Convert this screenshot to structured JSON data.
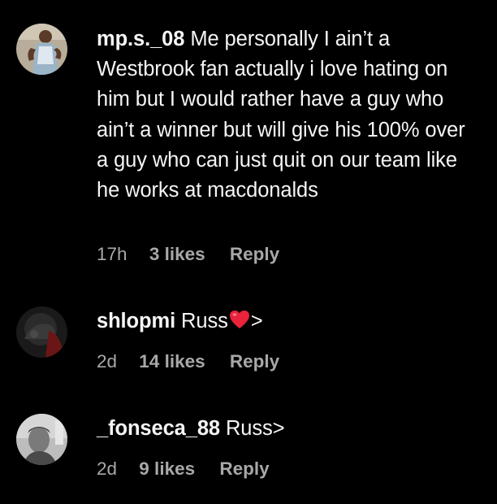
{
  "comments": [
    {
      "username": "mp.s._08",
      "text": " Me personally I ain’t a Westbrook fan actually i love hating on him but I would rather have a guy who ain’t a winner but will give his 100% over a guy who can just quit on our team like he works at macdonalds",
      "time": "17h",
      "likes": "3 likes",
      "reply": "Reply",
      "avatar_icon": "user-avatar-basketball-player"
    },
    {
      "username": "shlopmi",
      "text_before": " Russ",
      "text_after": ">",
      "emoji": "red-heart-icon",
      "time": "2d",
      "likes": "14 likes",
      "reply": "Reply",
      "avatar_icon": "user-avatar-dark"
    },
    {
      "username": "_fonseca_88",
      "text": " Russ>",
      "time": "2d",
      "likes": "9 likes",
      "reply": "Reply",
      "avatar_icon": "user-avatar-grayscale"
    }
  ],
  "colors": {
    "background": "#000000",
    "primary_text": "#f5f5f5",
    "secondary_text": "#a8a8a8",
    "heart": "#e8233b"
  }
}
